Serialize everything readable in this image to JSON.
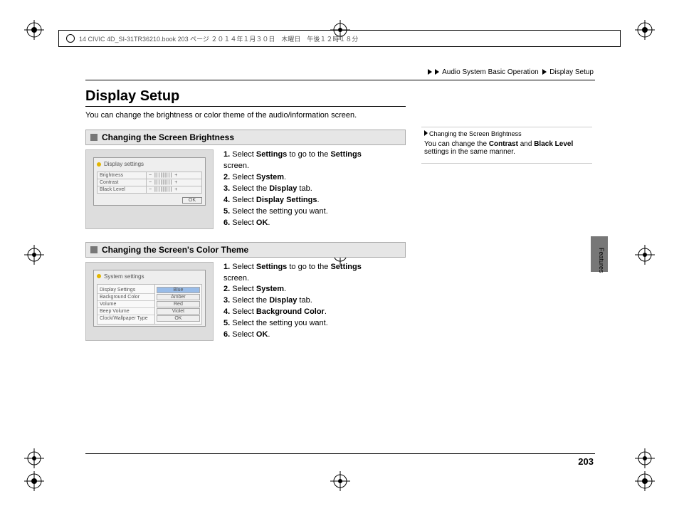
{
  "meta": {
    "file_info": "14 CIVIC 4D_SI-31TR36210.book  203 ページ  ２０１４年１月３０日　木曜日　午後１２時１８分"
  },
  "breadcrumb": {
    "a": "Audio System Basic Operation",
    "b": "Display Setup"
  },
  "title": "Display Setup",
  "intro": "You can change the brightness or color theme of the audio/information screen.",
  "sec1": {
    "heading": "Changing the Screen Brightness",
    "thumb_title": "Display settings",
    "rows": [
      "Brightness",
      "Contrast",
      "Black Level"
    ],
    "ok": "OK",
    "steps": [
      {
        "n": "1.",
        "t": "Select ",
        "b": "Settings",
        "t2": " to go to the ",
        "b2": "Settings",
        "t3": " screen."
      },
      {
        "n": "2.",
        "t": "Select ",
        "b": "System",
        "t2": "."
      },
      {
        "n": "3.",
        "t": "Select the ",
        "b": "Display",
        "t2": " tab."
      },
      {
        "n": "4.",
        "t": "Select ",
        "b": "Display Settings",
        "t2": "."
      },
      {
        "n": "5.",
        "t": "Select the setting you want."
      },
      {
        "n": "6.",
        "t": "Select ",
        "b": "OK",
        "t2": "."
      }
    ]
  },
  "sec2": {
    "heading": "Changing the Screen's Color Theme",
    "thumb_title": "System settings",
    "left_items": [
      "Display Settings",
      "Background Color",
      "Volume",
      "Beep Volume",
      "Clock/Wallpaper Type"
    ],
    "options": [
      "Blue",
      "Amber",
      "Red",
      "Violet",
      "OK"
    ],
    "steps": [
      {
        "n": "1.",
        "t": "Select ",
        "b": "Settings",
        "t2": " to go to the ",
        "b2": "Settings",
        "t3": " screen."
      },
      {
        "n": "2.",
        "t": "Select ",
        "b": "System",
        "t2": "."
      },
      {
        "n": "3.",
        "t": "Select the ",
        "b": "Display",
        "t2": " tab."
      },
      {
        "n": "4.",
        "t": "Select ",
        "b": "Background Color",
        "t2": "."
      },
      {
        "n": "5.",
        "t": "Select the setting you want."
      },
      {
        "n": "6.",
        "t": "Select ",
        "b": "OK",
        "t2": "."
      }
    ]
  },
  "sidenote": {
    "hd": "Changing the Screen Brightness",
    "line1a": "You can change the ",
    "line1b": "Contrast",
    "line1c": " and ",
    "line1d": "Black Level",
    "line2": "settings in the same manner."
  },
  "features_tab": "Features",
  "page_number": "203"
}
